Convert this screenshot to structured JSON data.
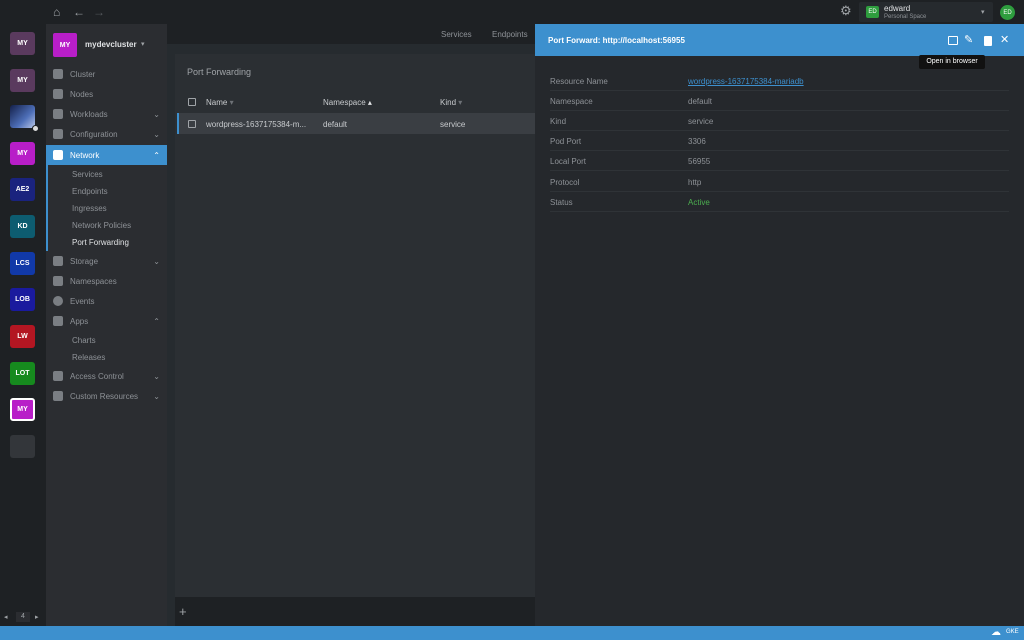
{
  "topbar": {
    "user_name": "edward",
    "user_space": "Personal Space",
    "user_initials": "ED",
    "avatar_initials": "ED"
  },
  "hotbar": {
    "clusters": [
      {
        "label": "MY",
        "color": "#5a3a5e"
      },
      {
        "label": "MY",
        "color": "#5a3a5e"
      },
      {
        "label": "",
        "color": "#2a3f6e"
      },
      {
        "label": "MY",
        "color": "#b81ec8"
      },
      {
        "label": "AE2",
        "color": "#1a237e"
      },
      {
        "label": "KD",
        "color": "#0d5c70"
      },
      {
        "label": "LCS",
        "color": "#1139a8"
      },
      {
        "label": "LOB",
        "color": "#1a1a9e"
      },
      {
        "label": "LW",
        "color": "#b31622"
      },
      {
        "label": "LOT",
        "color": "#168a1e"
      },
      {
        "label": "MY",
        "color": "#b81ec8"
      },
      {
        "label": "",
        "color": "#33363a"
      }
    ],
    "page_number": "4"
  },
  "sidebar": {
    "cluster_badge": "MY",
    "cluster_name": "mydevcluster",
    "items": [
      {
        "label": "Cluster"
      },
      {
        "label": "Nodes"
      },
      {
        "label": "Workloads"
      },
      {
        "label": "Configuration"
      },
      {
        "label": "Network"
      },
      {
        "label": "Storage"
      },
      {
        "label": "Namespaces"
      },
      {
        "label": "Events"
      },
      {
        "label": "Apps"
      },
      {
        "label": "Access Control"
      },
      {
        "label": "Custom Resources"
      }
    ],
    "network_sub": [
      "Services",
      "Endpoints",
      "Ingresses",
      "Network Policies",
      "Port Forwarding"
    ],
    "apps_sub": [
      "Charts",
      "Releases"
    ]
  },
  "main": {
    "tabs": [
      "Services",
      "Endpoints"
    ],
    "title": "Port Forwarding",
    "columns": [
      "Name",
      "Namespace",
      "Kind"
    ],
    "rows": [
      {
        "name": "wordpress-1637175384-m...",
        "namespace": "default",
        "kind": "service"
      }
    ]
  },
  "drawer": {
    "title": "Port Forward: http://localhost:56955",
    "tooltip": "Open in browser",
    "fields": [
      {
        "label": "Resource Name",
        "value": "wordpress-1637175384-mariadb"
      },
      {
        "label": "Namespace",
        "value": "default"
      },
      {
        "label": "Kind",
        "value": "service"
      },
      {
        "label": "Pod Port",
        "value": "3306"
      },
      {
        "label": "Local Port",
        "value": "56955"
      },
      {
        "label": "Protocol",
        "value": "http"
      },
      {
        "label": "Status",
        "value": "Active"
      }
    ]
  },
  "statusbar": {
    "right_label": "GKE"
  },
  "colors": {
    "accent": "#3d90ce",
    "active": "#4caf50",
    "link": "#3d90ce"
  }
}
